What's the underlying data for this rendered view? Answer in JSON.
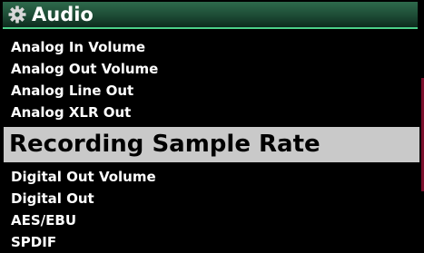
{
  "header": {
    "title": "Audio",
    "icon": "gear-icon",
    "gradient_top": "#2e6a4c",
    "gradient_bottom": "#0e2b1e",
    "accent_line": "#4bcf88"
  },
  "menu": {
    "items": [
      {
        "label": "Analog In Volume"
      },
      {
        "label": "Analog Out Volume"
      },
      {
        "label": "Analog Line Out"
      },
      {
        "label": "Analog XLR Out"
      },
      {
        "label": "Recording Sample Rate"
      },
      {
        "label": "Digital Out Volume"
      },
      {
        "label": "Digital Out"
      },
      {
        "label": "AES/EBU"
      },
      {
        "label": "SPDIF"
      }
    ],
    "selected_label": "Recording Sample Rate",
    "selected_bg": "#c9c9c9"
  },
  "scrollbar": {
    "color": "#7a0f2c"
  }
}
